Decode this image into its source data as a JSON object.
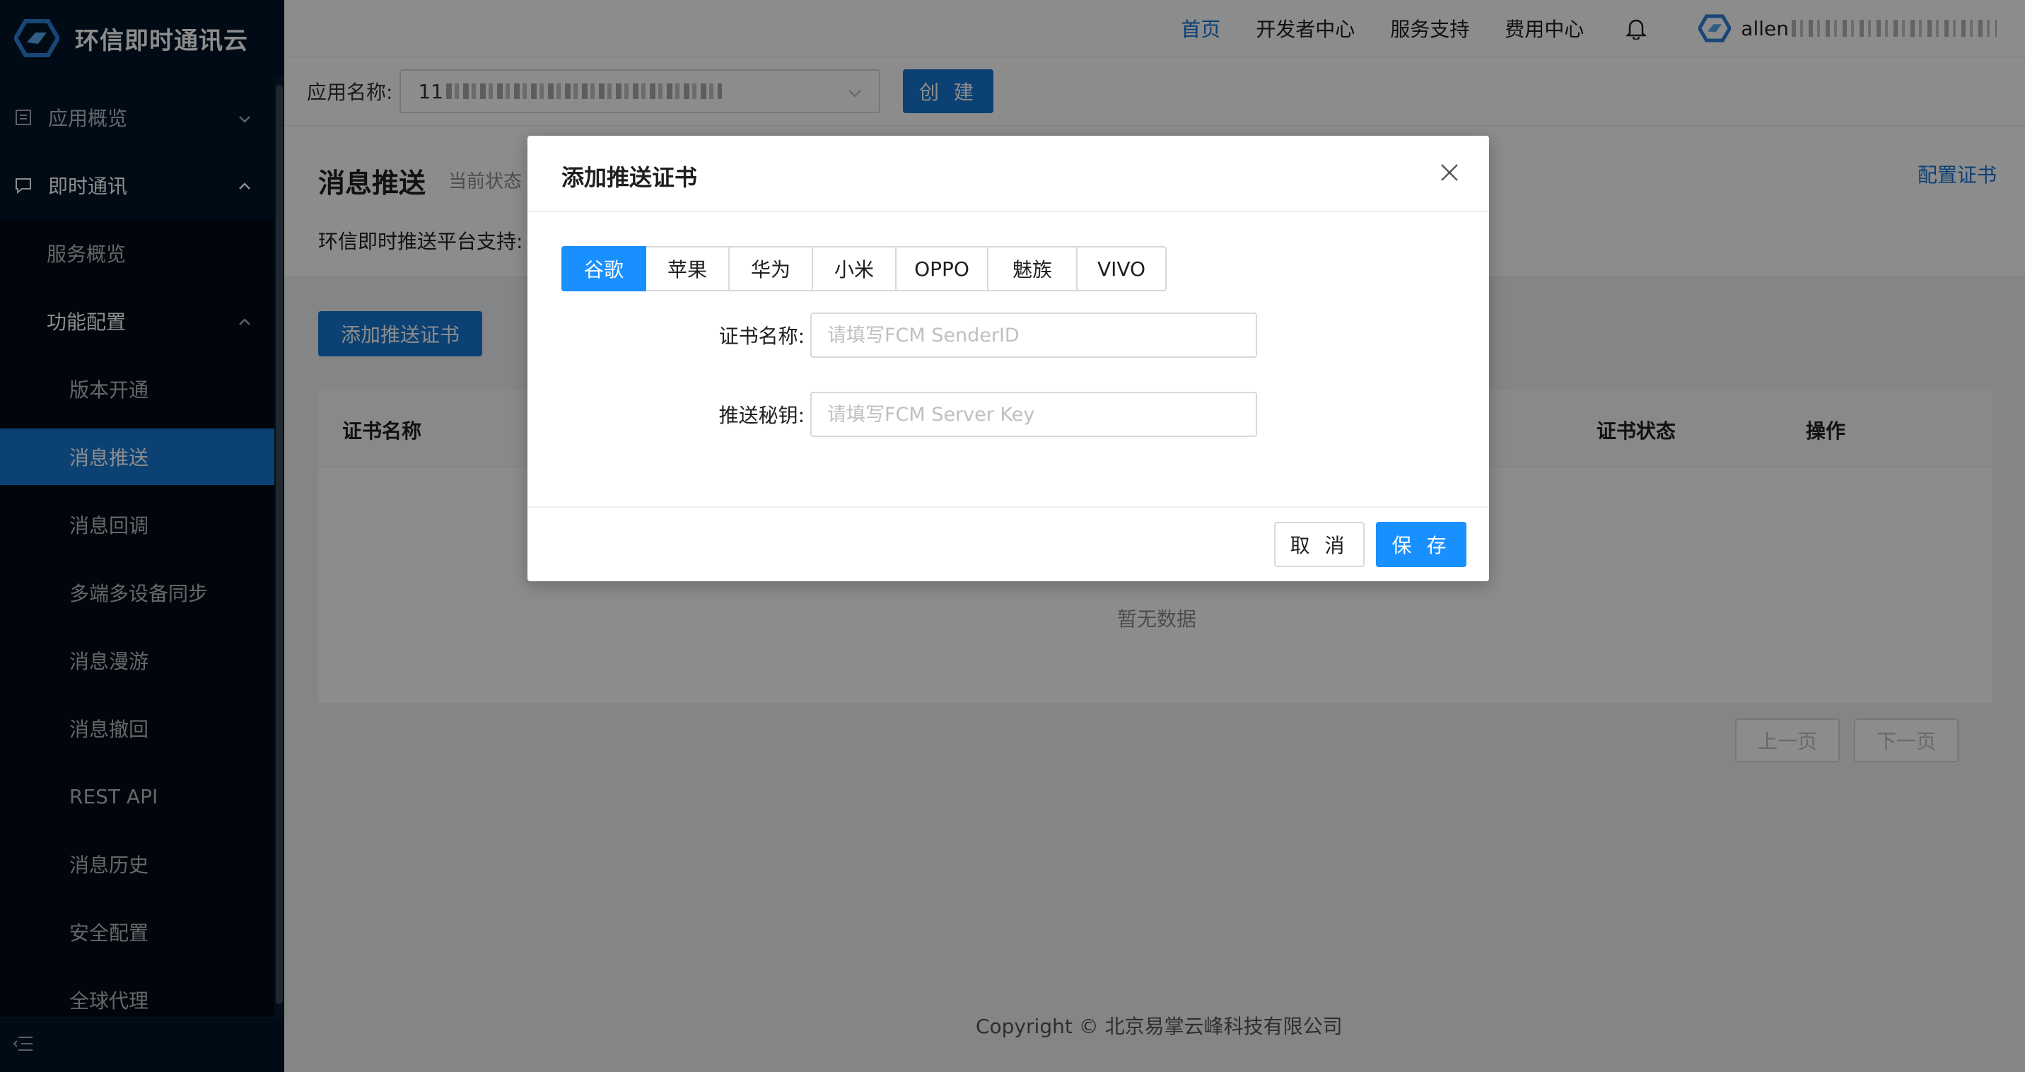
{
  "brand": {
    "name": "环信即时通讯云",
    "logo_icon": "easemob-logo"
  },
  "topnav": {
    "items": [
      "首页",
      "开发者中心",
      "服务支持",
      "费用中心"
    ],
    "active_index": 0,
    "user_prefix": "allen"
  },
  "appbar": {
    "label": "应用名称:",
    "app_value_prefix": "11",
    "create_label": "创 建"
  },
  "sidebar": {
    "groups": [
      {
        "label": "应用概览",
        "icon": "document-icon",
        "expanded": false
      },
      {
        "label": "即时通讯",
        "icon": "chat-icon",
        "expanded": true
      }
    ],
    "sub_items": [
      "服务概览",
      "功能配置"
    ],
    "leaf_items": [
      "版本开通",
      "消息推送",
      "消息回调",
      "多端多设备同步",
      "消息漫游",
      "消息撤回",
      "REST API",
      "消息历史",
      "安全配置",
      "全球代理"
    ],
    "active_leaf": "消息推送"
  },
  "page": {
    "title": "消息推送",
    "status_prefix": "当前状态",
    "platform_support": "环信即时推送平台支持:",
    "config_link": "配置证书",
    "add_button": "添加推送证书",
    "table_headers": {
      "cert_name": "证书名称",
      "cert_status": "证书状态",
      "actions": "操作"
    },
    "empty_text": "暂无数据",
    "prev_page": "上一页",
    "next_page": "下一页"
  },
  "footer": {
    "copyright": "Copyright © 北京易掌云峰科技有限公司"
  },
  "modal": {
    "title": "添加推送证书",
    "tabs": [
      "谷歌",
      "苹果",
      "华为",
      "小米",
      "OPPO",
      "魅族",
      "VIVO"
    ],
    "active_tab": "谷歌",
    "fields": {
      "cert_name_label": "证书名称:",
      "cert_name_placeholder": "请填写FCM SenderID",
      "cert_name_value": "",
      "secret_label": "推送秘钥:",
      "secret_placeholder": "请填写FCM Server Key",
      "secret_value": ""
    },
    "cancel_label": "取 消",
    "save_label": "保 存"
  },
  "colors": {
    "primary": "#1677d2",
    "sidebar_bg": "#001529",
    "tab_active": "#1890ff"
  }
}
